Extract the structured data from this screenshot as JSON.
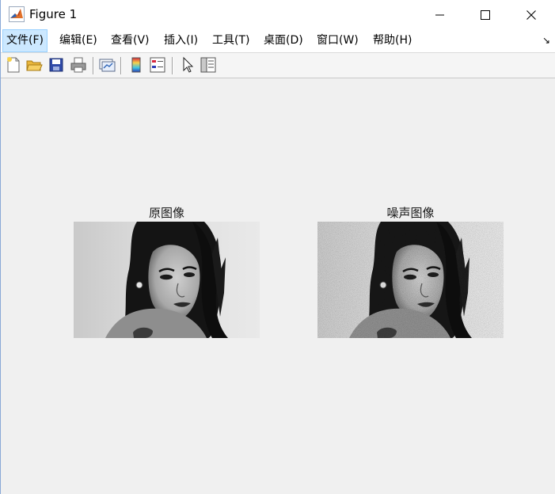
{
  "window": {
    "title": "Figure 1",
    "minimize_icon": "minimize-icon",
    "maximize_icon": "maximize-icon",
    "close_icon": "close-icon",
    "app_icon": "matlab-icon"
  },
  "menubar": {
    "items": [
      {
        "label": "文件(F)"
      },
      {
        "label": "编辑(E)"
      },
      {
        "label": "查看(V)"
      },
      {
        "label": "插入(I)"
      },
      {
        "label": "工具(T)"
      },
      {
        "label": "桌面(D)"
      },
      {
        "label": "窗口(W)"
      },
      {
        "label": "帮助(H)"
      }
    ],
    "dock_icon": "dock-arrow-icon"
  },
  "toolbar": {
    "icons": [
      "new-figure-icon",
      "open-file-icon",
      "save-icon",
      "print-icon",
      "link-plot-icon",
      "colorbar-icon",
      "legend-icon",
      "edit-plot-icon",
      "property-inspector-icon"
    ]
  },
  "axes": [
    {
      "title": "原图像"
    },
    {
      "title": "噪声图像"
    }
  ]
}
